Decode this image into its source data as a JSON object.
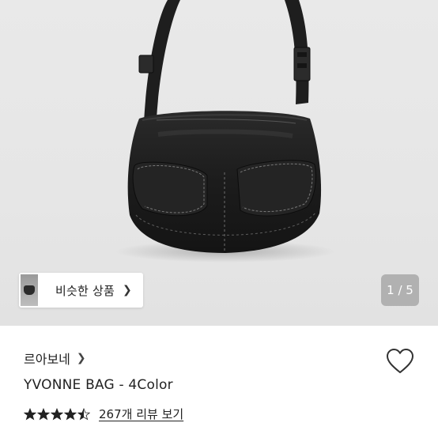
{
  "similar_products": {
    "label": "비슷한 상품",
    "chevron": "chevron-right-icon"
  },
  "gallery": {
    "current": 1,
    "total": 5,
    "indicator": "1 / 5"
  },
  "product": {
    "brand": "르아보네",
    "title": "YVONNE BAG - 4Color",
    "rating": 4.5,
    "review_link": "267개 리뷰 보기"
  },
  "icons": {
    "wishlist": "heart-outline-icon",
    "star": "star-icon",
    "chevron": "chevron-right-icon"
  },
  "colors": {
    "hero_bg": "#e6e6e6",
    "bag": "#1f1f1f",
    "text": "#222222",
    "pager_bg": "#a0a0a0"
  }
}
